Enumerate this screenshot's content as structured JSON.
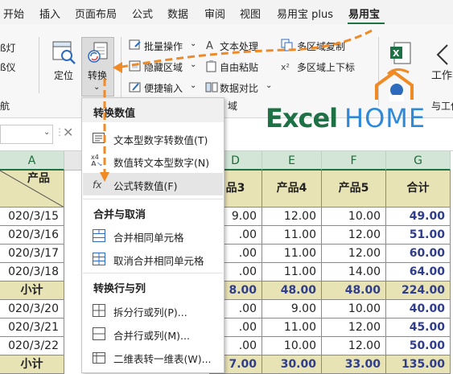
{
  "ribbon_tabs": [
    "开始",
    "插入",
    "页面布局",
    "公式",
    "数据",
    "审阅",
    "视图",
    "易用宝 plus",
    "易用宝"
  ],
  "ribbon": {
    "left_cut_1": "ß灯",
    "left_cut_2": "ß仪",
    "left_cut_3": "航",
    "locate": "定位",
    "convert": "转换",
    "batch_ops": "批量操作",
    "text_processing": "文本处理",
    "multi_copy": "多区域复制",
    "hide_area": "隐藏区域",
    "free_paste": "自由粘贴",
    "multi_upload": "多区域上下标",
    "quick_input": "便捷输入",
    "data_compare": "数据对比",
    "area_cut": "域",
    "workbook_cut": "工作表",
    "workbook_cut2": "与工作"
  },
  "logo": {
    "text_left": "Excel",
    "text_right": "HOME"
  },
  "menu": {
    "section1": "转换数值",
    "item_text_to_num": "文本型数字转数值(T)",
    "item_num_to_text": "数值转文本型数字(N)",
    "item_formula_to_value": "公式转数值(F)",
    "section2": "合并与取消",
    "item_merge_same": "合并相同单元格",
    "item_unmerge_same": "取消合并相同单元格",
    "section3": "转换行与列",
    "item_split": "拆分行或列(P)...",
    "item_merge_rc": "合并行或列(M)...",
    "item_2d_to_1d": "二维表转一维表(W)..."
  },
  "columns": [
    "A",
    "D",
    "E",
    "F",
    "G"
  ],
  "header": {
    "product": "产品",
    "p3": "品3",
    "p4": "产品4",
    "p5": "产品5",
    "total": "合计"
  },
  "rows": [
    {
      "a": "020/3/15",
      "d": "9.00",
      "e": "12.00",
      "f": "10.00",
      "g": "49.00",
      "sub": false
    },
    {
      "a": "020/3/16",
      "d": ".00",
      "e": "11.00",
      "f": "12.00",
      "g": "51.00",
      "sub": false
    },
    {
      "a": "020/3/17",
      "d": ".00",
      "e": "11.00",
      "f": "12.00",
      "g": "60.00",
      "sub": false
    },
    {
      "a": "020/3/18",
      "d": ".00",
      "e": "11.00",
      "f": "14.00",
      "g": "64.00",
      "sub": false
    },
    {
      "a": "小计",
      "d": "8.00",
      "e": "48.00",
      "f": "48.00",
      "g": "224.00",
      "sub": true
    },
    {
      "a": "020/3/20",
      "d": ".00",
      "e": "9.00",
      "f": "10.00",
      "g": "40.00",
      "sub": false
    },
    {
      "a": "020/3/21",
      "d": ".00",
      "e": "11.00",
      "f": "12.00",
      "g": "45.00",
      "sub": false
    },
    {
      "a": "020/3/22",
      "d": ".00",
      "e": "10.00",
      "f": "12.00",
      "g": "50.00",
      "sub": false
    },
    {
      "a": "小计",
      "d": "7.00",
      "e": "30.00",
      "f": "33.00",
      "g": "135.00",
      "sub": true
    }
  ],
  "colors": {
    "accent": "#1e7145",
    "arrow": "#f08a24",
    "subtotal_bg": "#e8e3b5",
    "total_text": "#2f3d8a"
  }
}
